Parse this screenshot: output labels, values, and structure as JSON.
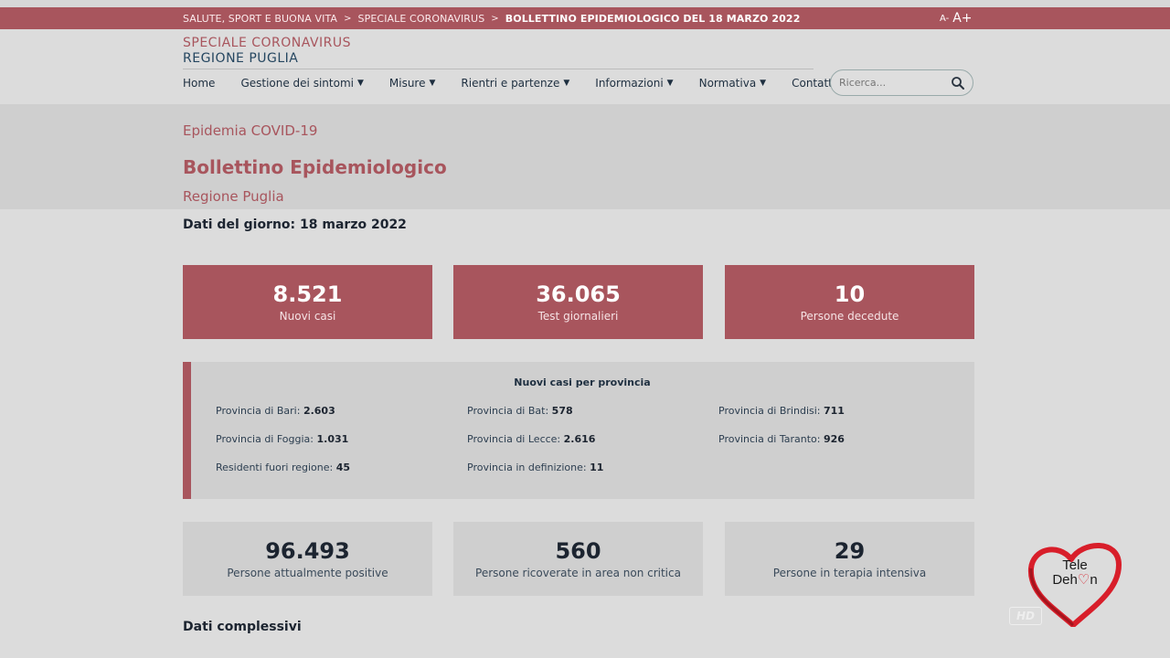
{
  "breadcrumb": {
    "items": [
      "SALUTE, SPORT E BUONA VITA",
      "SPECIALE CORONAVIRUS"
    ],
    "separator": ">",
    "current": "BOLLETTINO EPIDEMIOLOGICO DEL 18 MARZO 2022"
  },
  "font_controls": {
    "decrease": "A-",
    "increase": "A+"
  },
  "brand": {
    "line1": "SPECIALE CORONAVIRUS",
    "line2": "REGIONE PUGLIA"
  },
  "nav": [
    {
      "label": "Home",
      "dropdown": false
    },
    {
      "label": "Gestione dei sintomi",
      "dropdown": true
    },
    {
      "label": "Misure",
      "dropdown": true
    },
    {
      "label": "Rientri e partenze",
      "dropdown": true
    },
    {
      "label": "Informazioni",
      "dropdown": true
    },
    {
      "label": "Normativa",
      "dropdown": true
    },
    {
      "label": "Contatti",
      "dropdown": false
    }
  ],
  "search": {
    "placeholder": "Ricerca..."
  },
  "hero": {
    "pretitle": "Epidemia COVID-19",
    "title": "Bollettino Epidemiologico",
    "subtitle": "Regione Puglia"
  },
  "date_line": "Dati del giorno: 18 marzo 2022",
  "top_cards": [
    {
      "value": "8.521",
      "label": "Nuovi casi"
    },
    {
      "value": "36.065",
      "label": "Test giornalieri"
    },
    {
      "value": "10",
      "label": "Persone decedute"
    }
  ],
  "province": {
    "title": "Nuovi casi per provincia",
    "rows": [
      [
        {
          "label": "Provincia di Bari:",
          "value": "2.603"
        },
        {
          "label": "Provincia di Bat:",
          "value": "578"
        },
        {
          "label": "Provincia di Brindisi:",
          "value": "711"
        }
      ],
      [
        {
          "label": "Provincia di Foggia:",
          "value": "1.031"
        },
        {
          "label": "Provincia di Lecce:",
          "value": "2.616"
        },
        {
          "label": "Provincia di Taranto:",
          "value": "926"
        }
      ],
      [
        {
          "label": "Residenti fuori regione:",
          "value": "45"
        },
        {
          "label": "Provincia in definizione:",
          "value": "11"
        }
      ]
    ]
  },
  "bottom_cards": [
    {
      "value": "96.493",
      "label": "Persone attualmente positive"
    },
    {
      "value": "560",
      "label": "Persone ricoverate in area non critica"
    },
    {
      "value": "29",
      "label": "Persone in terapia intensiva"
    }
  ],
  "section_complessivi": "Dati complessivi",
  "logo": {
    "line1": "Tele",
    "line2_pre": "Deh",
    "line2_post": "n",
    "badge": "HD"
  },
  "colors": {
    "accent": "#a8555d",
    "navy": "#254660",
    "bg": "#dcdcdc",
    "panel": "#cfcfcf"
  }
}
